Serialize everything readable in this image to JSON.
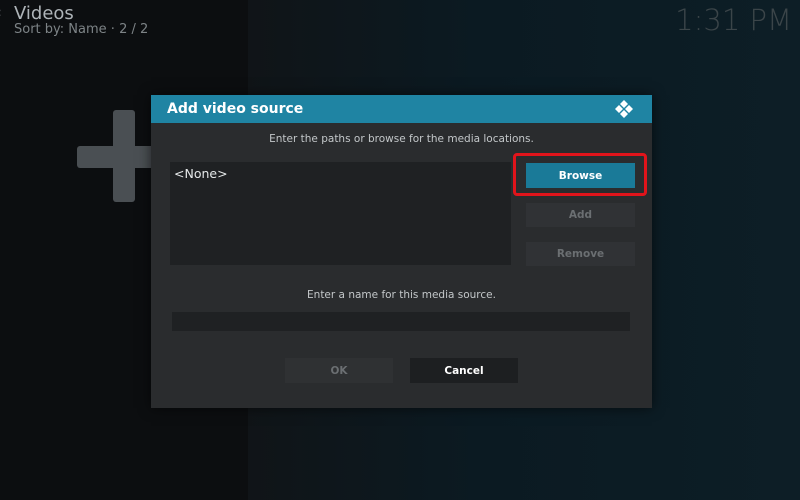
{
  "header": {
    "title": "Videos",
    "sort_label": "Sort by: Name",
    "page_counter": "2 / 2",
    "clock": "1:31 PM"
  },
  "background": {
    "add_icon": "plus-icon"
  },
  "dialog": {
    "title": "Add video source",
    "logo_icon": "kodi-logo-icon",
    "paths_hint": "Enter the paths or browse for the media locations.",
    "paths": [
      "<None>"
    ],
    "browse_label": "Browse",
    "add_label": "Add",
    "remove_label": "Remove",
    "name_hint": "Enter a name for this media source.",
    "name_value": "",
    "ok_label": "OK",
    "cancel_label": "Cancel"
  },
  "colors": {
    "header_accent": "#1f84a3",
    "focused_button": "#1a7a98",
    "highlight_outline": "#e1141b",
    "dialog_bg": "#2a2c2e"
  }
}
